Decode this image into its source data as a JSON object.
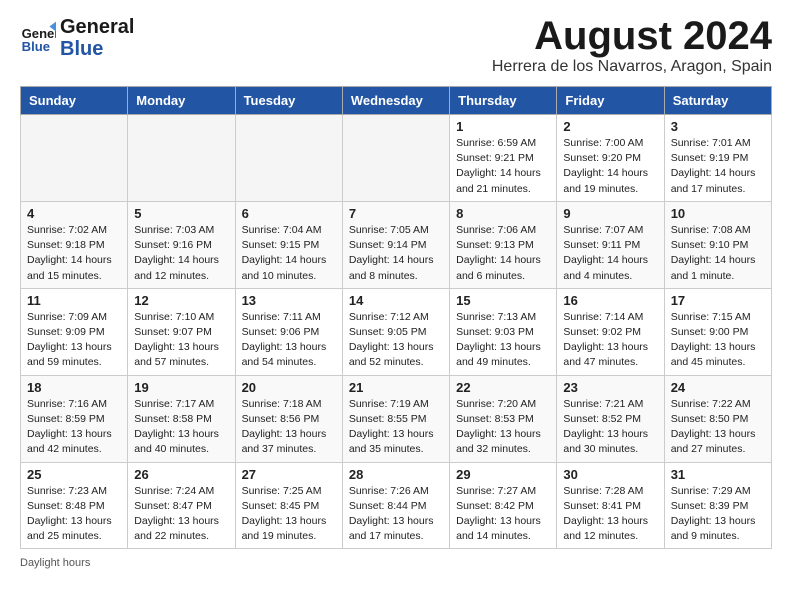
{
  "header": {
    "logo_general": "General",
    "logo_blue": "Blue",
    "month_title": "August 2024",
    "location": "Herrera de los Navarros, Aragon, Spain"
  },
  "days_of_week": [
    "Sunday",
    "Monday",
    "Tuesday",
    "Wednesday",
    "Thursday",
    "Friday",
    "Saturday"
  ],
  "weeks": [
    [
      {
        "day": "",
        "empty": true
      },
      {
        "day": "",
        "empty": true
      },
      {
        "day": "",
        "empty": true
      },
      {
        "day": "",
        "empty": true
      },
      {
        "day": "1",
        "sunrise": "6:59 AM",
        "sunset": "9:21 PM",
        "daylight": "14 hours and 21 minutes."
      },
      {
        "day": "2",
        "sunrise": "7:00 AM",
        "sunset": "9:20 PM",
        "daylight": "14 hours and 19 minutes."
      },
      {
        "day": "3",
        "sunrise": "7:01 AM",
        "sunset": "9:19 PM",
        "daylight": "14 hours and 17 minutes."
      }
    ],
    [
      {
        "day": "4",
        "sunrise": "7:02 AM",
        "sunset": "9:18 PM",
        "daylight": "14 hours and 15 minutes."
      },
      {
        "day": "5",
        "sunrise": "7:03 AM",
        "sunset": "9:16 PM",
        "daylight": "14 hours and 12 minutes."
      },
      {
        "day": "6",
        "sunrise": "7:04 AM",
        "sunset": "9:15 PM",
        "daylight": "14 hours and 10 minutes."
      },
      {
        "day": "7",
        "sunrise": "7:05 AM",
        "sunset": "9:14 PM",
        "daylight": "14 hours and 8 minutes."
      },
      {
        "day": "8",
        "sunrise": "7:06 AM",
        "sunset": "9:13 PM",
        "daylight": "14 hours and 6 minutes."
      },
      {
        "day": "9",
        "sunrise": "7:07 AM",
        "sunset": "9:11 PM",
        "daylight": "14 hours and 4 minutes."
      },
      {
        "day": "10",
        "sunrise": "7:08 AM",
        "sunset": "9:10 PM",
        "daylight": "14 hours and 1 minute."
      }
    ],
    [
      {
        "day": "11",
        "sunrise": "7:09 AM",
        "sunset": "9:09 PM",
        "daylight": "13 hours and 59 minutes."
      },
      {
        "day": "12",
        "sunrise": "7:10 AM",
        "sunset": "9:07 PM",
        "daylight": "13 hours and 57 minutes."
      },
      {
        "day": "13",
        "sunrise": "7:11 AM",
        "sunset": "9:06 PM",
        "daylight": "13 hours and 54 minutes."
      },
      {
        "day": "14",
        "sunrise": "7:12 AM",
        "sunset": "9:05 PM",
        "daylight": "13 hours and 52 minutes."
      },
      {
        "day": "15",
        "sunrise": "7:13 AM",
        "sunset": "9:03 PM",
        "daylight": "13 hours and 49 minutes."
      },
      {
        "day": "16",
        "sunrise": "7:14 AM",
        "sunset": "9:02 PM",
        "daylight": "13 hours and 47 minutes."
      },
      {
        "day": "17",
        "sunrise": "7:15 AM",
        "sunset": "9:00 PM",
        "daylight": "13 hours and 45 minutes."
      }
    ],
    [
      {
        "day": "18",
        "sunrise": "7:16 AM",
        "sunset": "8:59 PM",
        "daylight": "13 hours and 42 minutes."
      },
      {
        "day": "19",
        "sunrise": "7:17 AM",
        "sunset": "8:58 PM",
        "daylight": "13 hours and 40 minutes."
      },
      {
        "day": "20",
        "sunrise": "7:18 AM",
        "sunset": "8:56 PM",
        "daylight": "13 hours and 37 minutes."
      },
      {
        "day": "21",
        "sunrise": "7:19 AM",
        "sunset": "8:55 PM",
        "daylight": "13 hours and 35 minutes."
      },
      {
        "day": "22",
        "sunrise": "7:20 AM",
        "sunset": "8:53 PM",
        "daylight": "13 hours and 32 minutes."
      },
      {
        "day": "23",
        "sunrise": "7:21 AM",
        "sunset": "8:52 PM",
        "daylight": "13 hours and 30 minutes."
      },
      {
        "day": "24",
        "sunrise": "7:22 AM",
        "sunset": "8:50 PM",
        "daylight": "13 hours and 27 minutes."
      }
    ],
    [
      {
        "day": "25",
        "sunrise": "7:23 AM",
        "sunset": "8:48 PM",
        "daylight": "13 hours and 25 minutes."
      },
      {
        "day": "26",
        "sunrise": "7:24 AM",
        "sunset": "8:47 PM",
        "daylight": "13 hours and 22 minutes."
      },
      {
        "day": "27",
        "sunrise": "7:25 AM",
        "sunset": "8:45 PM",
        "daylight": "13 hours and 19 minutes."
      },
      {
        "day": "28",
        "sunrise": "7:26 AM",
        "sunset": "8:44 PM",
        "daylight": "13 hours and 17 minutes."
      },
      {
        "day": "29",
        "sunrise": "7:27 AM",
        "sunset": "8:42 PM",
        "daylight": "13 hours and 14 minutes."
      },
      {
        "day": "30",
        "sunrise": "7:28 AM",
        "sunset": "8:41 PM",
        "daylight": "13 hours and 12 minutes."
      },
      {
        "day": "31",
        "sunrise": "7:29 AM",
        "sunset": "8:39 PM",
        "daylight": "13 hours and 9 minutes."
      }
    ]
  ],
  "legend": {
    "daylight_hours_label": "Daylight hours"
  }
}
